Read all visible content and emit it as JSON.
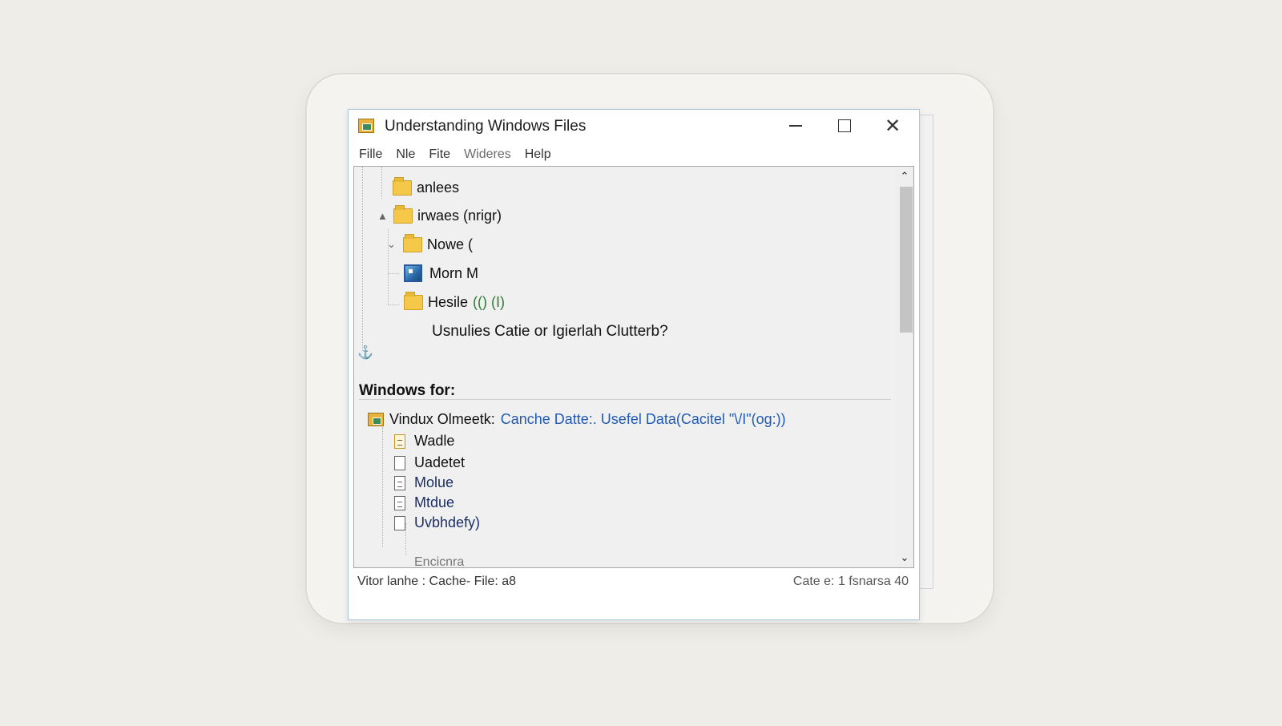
{
  "window": {
    "title": "Understanding Windows Files",
    "controls": {
      "minimize_icon": "minimize-icon",
      "maximize_icon": "maximize-icon",
      "close_icon": "close-icon"
    }
  },
  "menu": [
    "Fille",
    "Nle",
    "Fite",
    "Wideres",
    "Help"
  ],
  "tree": {
    "items": [
      {
        "label": "anlees",
        "icon": "folder-icon"
      },
      {
        "label": "irwaes (nrigr)",
        "icon": "folder-icon",
        "expander": "▲"
      },
      {
        "label": "Nowe (",
        "icon": "folder-icon",
        "expander": "⌄"
      },
      {
        "label": "Morn M",
        "icon": "image-icon"
      },
      {
        "label": "Hesile",
        "suffix": "(() (I)",
        "icon": "folder-icon"
      }
    ],
    "question": "Usnulies Catie or Igierlah Clutterb?",
    "anchor_glyph": "⚓"
  },
  "section": {
    "heading": "Windows for:",
    "root": {
      "label": "Vindux Olmeetk:",
      "blue_text": "Canche Datte:. Usefel Data",
      "suffix": "(Cacitel \"\\/I\"(og:))",
      "icon": "app-icon"
    },
    "files": [
      {
        "label": "Wadle",
        "icon": "file-warm-icon"
      },
      {
        "label": "Uadetet",
        "icon": "file-icon"
      },
      {
        "label": "Molue",
        "icon": "document-icon"
      },
      {
        "label": "Mtdue",
        "icon": "document-icon"
      },
      {
        "label": "Uvbhdefy)",
        "icon": "file-icon"
      }
    ],
    "faded": "Encicnra"
  },
  "status": {
    "left": "Vitor lanhe :  Cache- File: a8",
    "right": "Cate e: 1 fsnarsa 40"
  },
  "scrollbar": {
    "up_glyph": "⌃",
    "down_glyph": "⌄"
  },
  "colors": {
    "accent_blue": "#1f5bb5",
    "folder_yellow": "#f5c84a",
    "green": "#2f7b2f"
  }
}
